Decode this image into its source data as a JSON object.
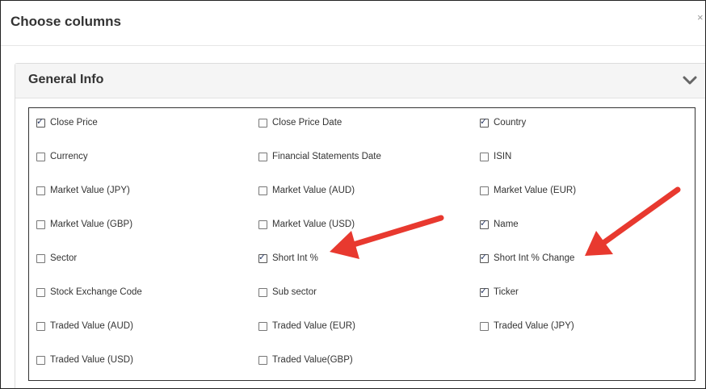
{
  "dialog": {
    "title": "Choose columns",
    "close_glyph": "×"
  },
  "panel": {
    "title": "General Info",
    "collapse_icon": "chevron-down-icon"
  },
  "columns": [
    {
      "label": "Close Price",
      "checked": true
    },
    {
      "label": "Close Price Date",
      "checked": false
    },
    {
      "label": "Country",
      "checked": true
    },
    {
      "label": "Currency",
      "checked": false
    },
    {
      "label": "Financial Statements Date",
      "checked": false
    },
    {
      "label": "ISIN",
      "checked": false
    },
    {
      "label": "Market Value (JPY)",
      "checked": false
    },
    {
      "label": "Market Value (AUD)",
      "checked": false
    },
    {
      "label": "Market Value (EUR)",
      "checked": false
    },
    {
      "label": "Market Value (GBP)",
      "checked": false
    },
    {
      "label": "Market Value (USD)",
      "checked": false
    },
    {
      "label": "Name",
      "checked": true
    },
    {
      "label": "Sector",
      "checked": false
    },
    {
      "label": "Short Int %",
      "checked": true
    },
    {
      "label": "Short Int % Change",
      "checked": true
    },
    {
      "label": "Stock Exchange Code",
      "checked": false
    },
    {
      "label": "Sub sector",
      "checked": false
    },
    {
      "label": "Ticker",
      "checked": true
    },
    {
      "label": "Traded Value (AUD)",
      "checked": false
    },
    {
      "label": "Traded Value (EUR)",
      "checked": false
    },
    {
      "label": "Traded Value (JPY)",
      "checked": false
    },
    {
      "label": "Traded Value (USD)",
      "checked": false
    },
    {
      "label": "Traded Value(GBP)",
      "checked": false
    }
  ],
  "colors": {
    "arrow": "#e8392f",
    "check": "#2a3a66",
    "grid_border": "#333333"
  }
}
